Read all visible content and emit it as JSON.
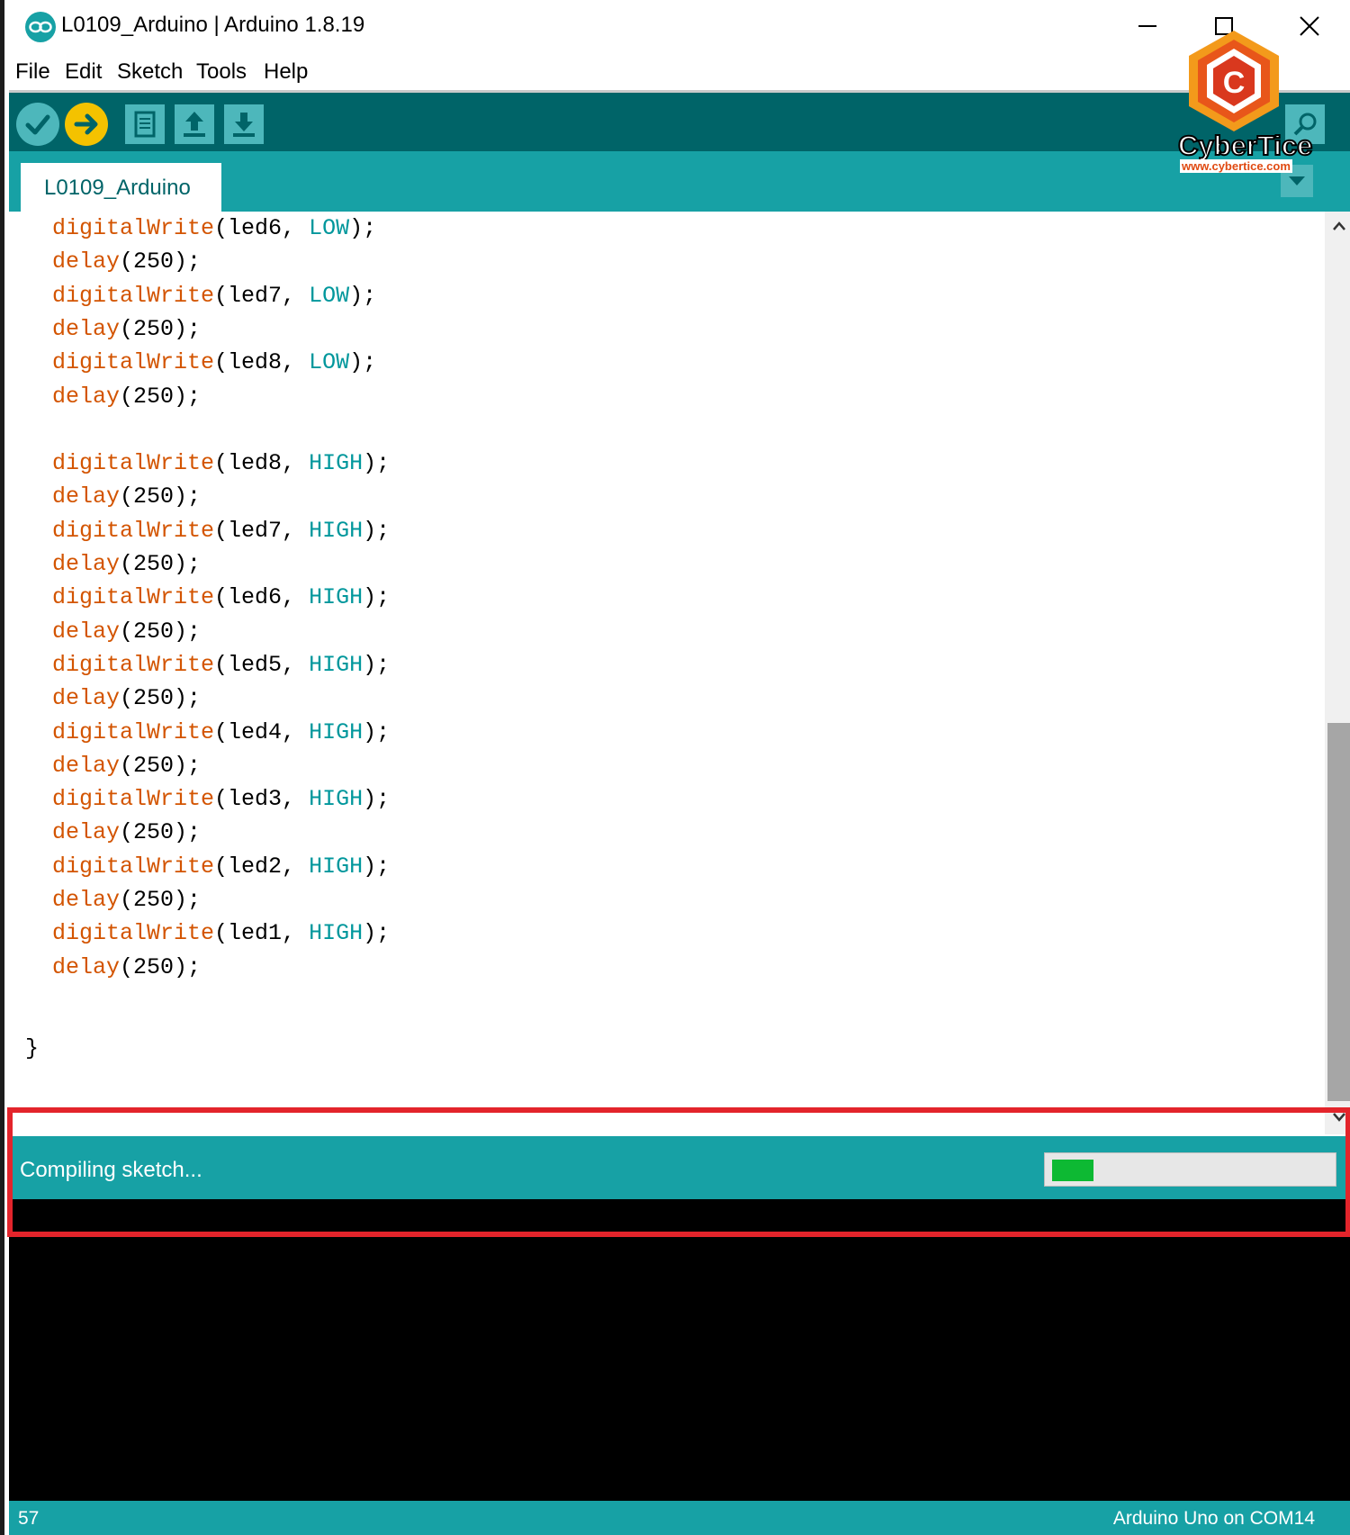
{
  "window": {
    "title": "L0109_Arduino | Arduino 1.8.19"
  },
  "menu": {
    "items": [
      "File",
      "Edit",
      "Sketch",
      "Tools",
      "Help"
    ]
  },
  "toolbar": {
    "buttons": [
      "verify",
      "upload",
      "new",
      "open",
      "save",
      "serial-monitor"
    ]
  },
  "tabs": {
    "active": "L0109_Arduino"
  },
  "editor": {
    "lines": [
      {
        "fn": "digitalWrite",
        "arg": "(led6, ",
        "const": "LOW",
        "end": ");"
      },
      {
        "fn": "delay",
        "arg": "(250);",
        "const": "",
        "end": ""
      },
      {
        "fn": "digitalWrite",
        "arg": "(led7, ",
        "const": "LOW",
        "end": ");"
      },
      {
        "fn": "delay",
        "arg": "(250);",
        "const": "",
        "end": ""
      },
      {
        "fn": "digitalWrite",
        "arg": "(led8, ",
        "const": "LOW",
        "end": ");"
      },
      {
        "fn": "delay",
        "arg": "(250);",
        "const": "",
        "end": ""
      },
      {
        "fn": "",
        "arg": "",
        "const": "",
        "end": ""
      },
      {
        "fn": "digitalWrite",
        "arg": "(led8, ",
        "const": "HIGH",
        "end": ");"
      },
      {
        "fn": "delay",
        "arg": "(250);",
        "const": "",
        "end": ""
      },
      {
        "fn": "digitalWrite",
        "arg": "(led7, ",
        "const": "HIGH",
        "end": ");"
      },
      {
        "fn": "delay",
        "arg": "(250);",
        "const": "",
        "end": ""
      },
      {
        "fn": "digitalWrite",
        "arg": "(led6, ",
        "const": "HIGH",
        "end": ");"
      },
      {
        "fn": "delay",
        "arg": "(250);",
        "const": "",
        "end": ""
      },
      {
        "fn": "digitalWrite",
        "arg": "(led5, ",
        "const": "HIGH",
        "end": ");"
      },
      {
        "fn": "delay",
        "arg": "(250);",
        "const": "",
        "end": ""
      },
      {
        "fn": "digitalWrite",
        "arg": "(led4, ",
        "const": "HIGH",
        "end": ");"
      },
      {
        "fn": "delay",
        "arg": "(250);",
        "const": "",
        "end": ""
      },
      {
        "fn": "digitalWrite",
        "arg": "(led3, ",
        "const": "HIGH",
        "end": ");"
      },
      {
        "fn": "delay",
        "arg": "(250);",
        "const": "",
        "end": ""
      },
      {
        "fn": "digitalWrite",
        "arg": "(led2, ",
        "const": "HIGH",
        "end": ");"
      },
      {
        "fn": "delay",
        "arg": "(250);",
        "const": "",
        "end": ""
      },
      {
        "fn": "digitalWrite",
        "arg": "(led1, ",
        "const": "HIGH",
        "end": ");"
      },
      {
        "fn": "delay",
        "arg": "(250);",
        "const": "",
        "end": ""
      }
    ],
    "closing_brace": "}"
  },
  "status": {
    "message": "Compiling sketch...",
    "progress": 0.15
  },
  "footer": {
    "line_number": "57",
    "board": "Arduino Uno on COM14"
  },
  "watermark": {
    "brand": "CyberTice",
    "url": "www.cybertice.com"
  },
  "colors": {
    "toolbar": "#006468",
    "accent": "#17a1a5",
    "keyword": "#d35400",
    "constant": "#00979c",
    "progress": "#0db933",
    "highlight": "#e3242b"
  }
}
